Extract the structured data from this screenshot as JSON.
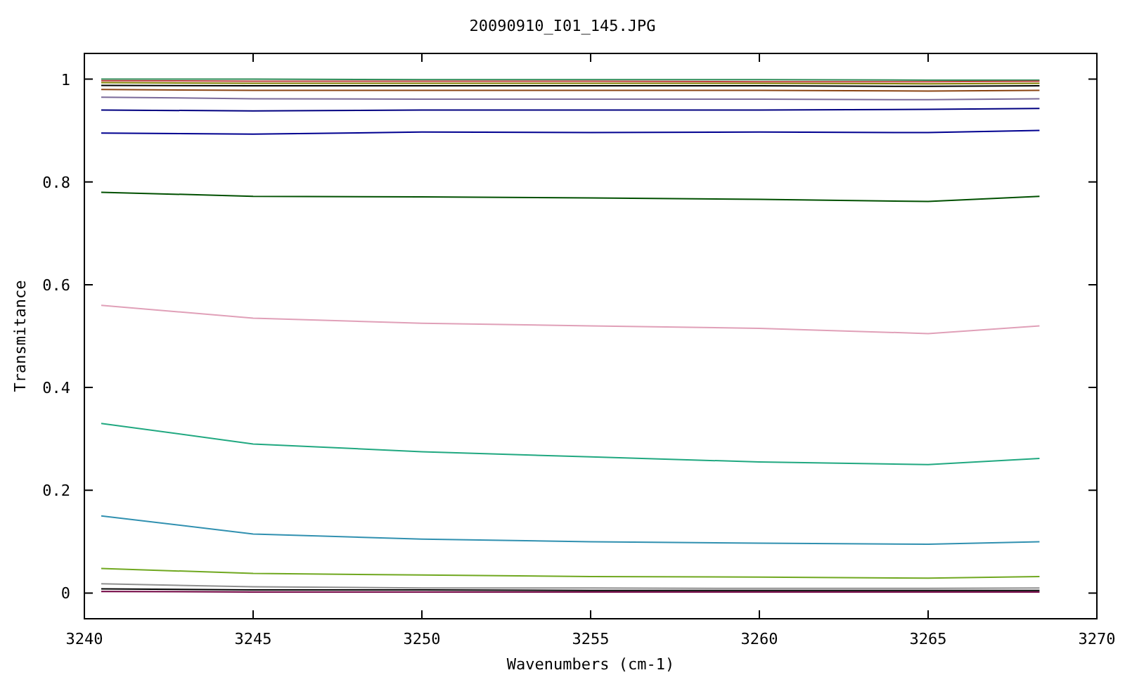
{
  "chart_data": {
    "type": "line",
    "title": "20090910_I01_145.JPG",
    "xlabel": "Wavenumbers (cm-1)",
    "ylabel": "Transmitance",
    "x": [
      3240.5,
      3245,
      3250,
      3255,
      3260,
      3265,
      3268.3
    ],
    "xlim": [
      3240,
      3270
    ],
    "ylim": [
      -0.05,
      1.05
    ],
    "xticks": [
      3240,
      3245,
      3250,
      3255,
      3260,
      3265,
      3270
    ],
    "yticks": [
      {
        "value": 0,
        "label": "0"
      },
      {
        "value": 0.2,
        "label": "0.2"
      },
      {
        "value": 0.4,
        "label": "0.4"
      },
      {
        "value": 0.6,
        "label": "0.6"
      },
      {
        "value": 0.8,
        "label": "0.8"
      },
      {
        "value": 1,
        "label": "1"
      }
    ],
    "series": [
      {
        "color": "#2e8b57",
        "values": [
          1.0,
          1.0,
          0.999,
          0.999,
          0.999,
          0.998,
          0.998
        ]
      },
      {
        "color": "#c04040",
        "values": [
          0.997,
          0.996,
          0.996,
          0.996,
          0.995,
          0.995,
          0.996
        ]
      },
      {
        "color": "#808000",
        "values": [
          0.993,
          0.992,
          0.992,
          0.992,
          0.992,
          0.991,
          0.992
        ]
      },
      {
        "color": "#000000",
        "values": [
          0.988,
          0.987,
          0.987,
          0.987,
          0.987,
          0.986,
          0.987
        ]
      },
      {
        "color": "#8b4513",
        "values": [
          0.98,
          0.978,
          0.978,
          0.978,
          0.978,
          0.977,
          0.978
        ]
      },
      {
        "color": "#7a6a9a",
        "values": [
          0.965,
          0.962,
          0.961,
          0.961,
          0.961,
          0.96,
          0.962
        ]
      },
      {
        "color": "#000080",
        "values": [
          0.94,
          0.938,
          0.94,
          0.94,
          0.94,
          0.941,
          0.943
        ]
      },
      {
        "color": "#000090",
        "values": [
          0.895,
          0.893,
          0.897,
          0.896,
          0.897,
          0.896,
          0.9
        ]
      },
      {
        "color": "#005000",
        "values": [
          0.78,
          0.772,
          0.771,
          0.769,
          0.766,
          0.762,
          0.772
        ]
      },
      {
        "color": "#e0a0b8",
        "values": [
          0.56,
          0.535,
          0.525,
          0.52,
          0.515,
          0.505,
          0.52
        ]
      },
      {
        "color": "#20a880",
        "values": [
          0.33,
          0.29,
          0.275,
          0.265,
          0.255,
          0.25,
          0.262
        ]
      },
      {
        "color": "#3090b0",
        "values": [
          0.15,
          0.115,
          0.105,
          0.1,
          0.097,
          0.095,
          0.1
        ]
      },
      {
        "color": "#70a820",
        "values": [
          0.048,
          0.038,
          0.035,
          0.032,
          0.031,
          0.029,
          0.032
        ]
      },
      {
        "color": "#909090",
        "values": [
          0.018,
          0.012,
          0.01,
          0.01,
          0.009,
          0.009,
          0.01
        ]
      },
      {
        "color": "#000000",
        "values": [
          0.008,
          0.006,
          0.006,
          0.005,
          0.005,
          0.005,
          0.005
        ]
      },
      {
        "color": "#700040",
        "values": [
          0.003,
          0.002,
          0.002,
          0.002,
          0.002,
          0.002,
          0.002
        ]
      }
    ]
  }
}
